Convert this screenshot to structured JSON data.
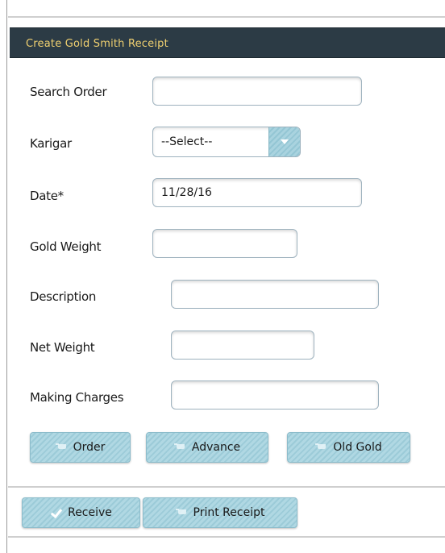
{
  "form": {
    "title": "Create Gold Smith Receipt",
    "fields": {
      "search_order": {
        "label": "Search Order",
        "value": ""
      },
      "karigar": {
        "label": "Karigar",
        "value": "--Select--"
      },
      "date": {
        "label": "Date*",
        "value": "11/28/16"
      },
      "gold_weight": {
        "label": "Gold Weight",
        "value": ""
      },
      "description": {
        "label": "Description",
        "value": ""
      },
      "net_weight": {
        "label": "Net Weight",
        "value": ""
      },
      "making_charges": {
        "label": "Making Charges",
        "value": ""
      }
    },
    "buttons": {
      "order": "Order",
      "advance": "Advance",
      "old_gold": "Old Gold"
    }
  },
  "footer": {
    "receive": "Receive",
    "print_receipt": "Print Receipt"
  },
  "icons": {
    "cart": "cart-icon",
    "check": "check-icon",
    "dropdown": "chevron-down-icon"
  },
  "colors": {
    "title_bar": "#2c3b45",
    "title_text": "#f0d070",
    "button": "#a9d3df"
  }
}
